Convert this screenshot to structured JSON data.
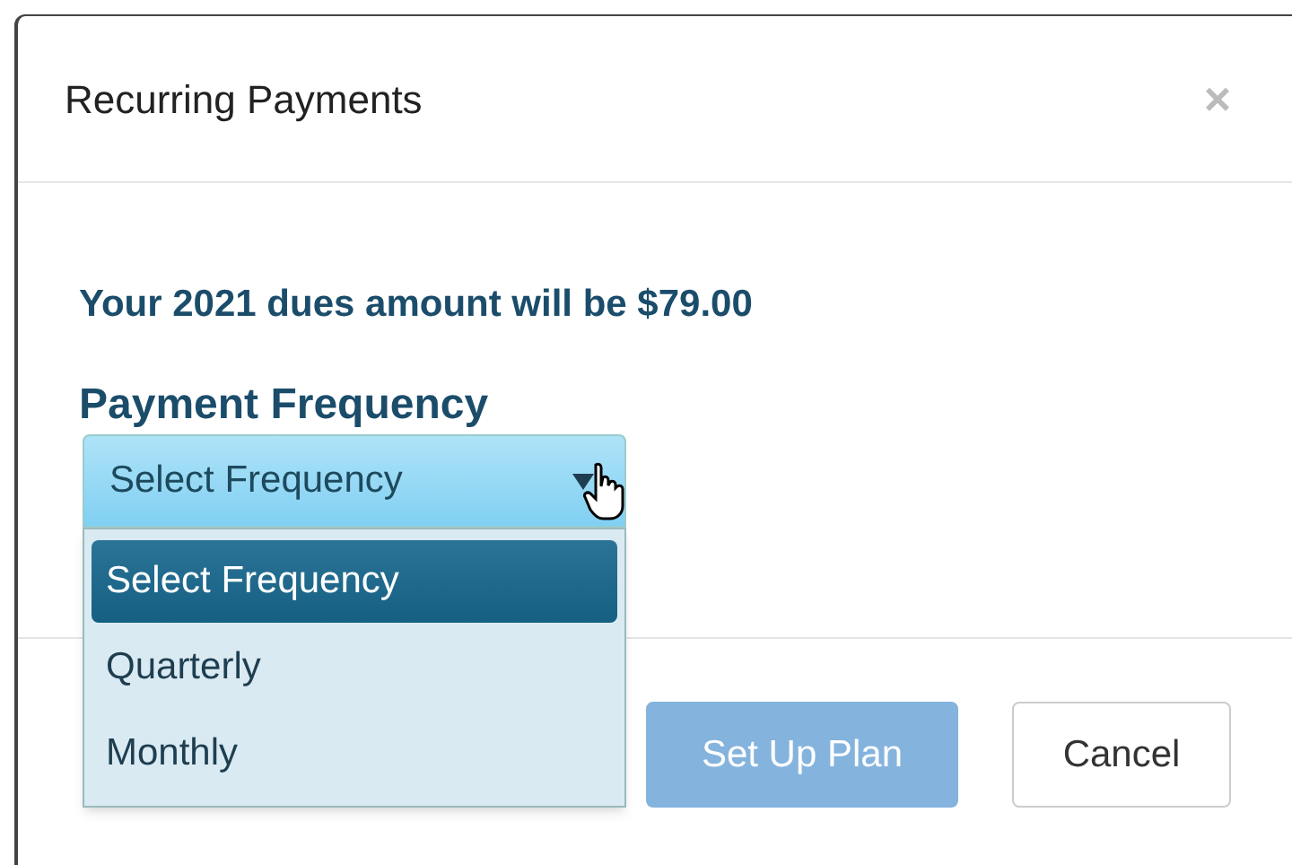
{
  "dialog": {
    "title": "Recurring Payments",
    "close": "×"
  },
  "message": "Your 2021 dues amount will be $79.00",
  "frequency": {
    "label": "Payment Frequency",
    "value": "Select Frequency",
    "expanded": true,
    "options": [
      {
        "label": "Select Frequency",
        "selected": true
      },
      {
        "label": "Quarterly",
        "selected": false
      },
      {
        "label": "Monthly",
        "selected": false
      }
    ]
  },
  "buttons": [
    {
      "label": "Set Up Plan",
      "kind": "primary",
      "disabled": true
    },
    {
      "label": "Cancel",
      "kind": "default",
      "disabled": false
    }
  ]
}
